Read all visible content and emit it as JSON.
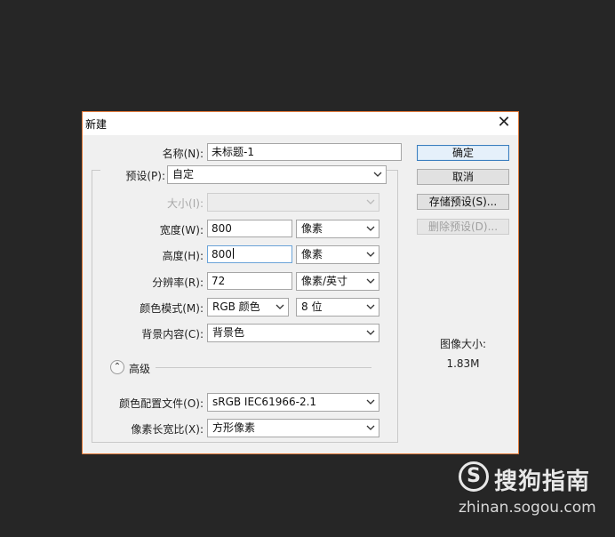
{
  "dialog": {
    "title": "新建",
    "fields": {
      "name_label": "名称(N):",
      "name_value": "未标题-1",
      "preset_label": "预设(P):",
      "preset_value": "自定",
      "size_label": "大小(I):",
      "size_value": "",
      "width_label": "宽度(W):",
      "width_value": "800",
      "width_unit": "像素",
      "height_label": "高度(H):",
      "height_value": "800",
      "height_unit": "像素",
      "resolution_label": "分辨率(R):",
      "resolution_value": "72",
      "resolution_unit": "像素/英寸",
      "color_mode_label": "颜色模式(M):",
      "color_mode_value": "RGB 颜色",
      "bit_depth_value": "8 位",
      "background_label": "背景内容(C):",
      "background_value": "背景色",
      "advanced_label": "高级",
      "color_profile_label": "颜色配置文件(O):",
      "color_profile_value": "sRGB IEC61966-2.1",
      "pixel_aspect_label": "像素长宽比(X):",
      "pixel_aspect_value": "方形像素"
    },
    "buttons": {
      "ok": "确定",
      "cancel": "取消",
      "save_preset": "存储预设(S)...",
      "delete_preset": "删除预设(D)..."
    },
    "image_size": {
      "label": "图像大小:",
      "value": "1.83M"
    }
  },
  "watermark": {
    "logo_glyph": "S",
    "name": "搜狗指南",
    "url": "zhinan.sogou.com"
  },
  "colors": {
    "backdrop": "#262626",
    "dialog_bg": "#f0f0f0",
    "dialog_border": "#e07a3a",
    "focus_border": "#6aa3d8"
  }
}
